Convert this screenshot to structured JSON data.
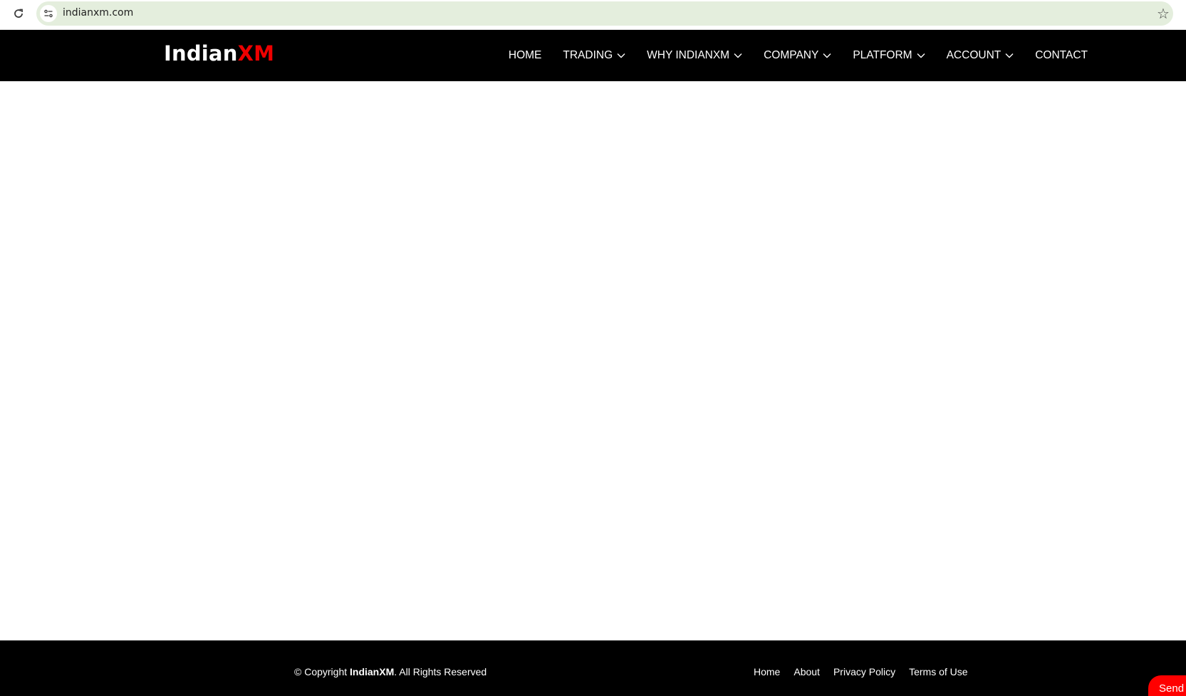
{
  "browser": {
    "url": "indianxm.com",
    "icons": {
      "reload": "reload-icon",
      "site_info": "site-settings-icon",
      "bookmark": "star-icon"
    }
  },
  "header": {
    "logo": {
      "main": "Indian",
      "accent": "XM"
    },
    "nav": [
      {
        "label": "HOME",
        "dropdown": false
      },
      {
        "label": "TRADING",
        "dropdown": true
      },
      {
        "label": "WHY INDIANXM",
        "dropdown": true
      },
      {
        "label": "COMPANY",
        "dropdown": true
      },
      {
        "label": "PLATFORM",
        "dropdown": true
      },
      {
        "label": "ACCOUNT",
        "dropdown": true
      },
      {
        "label": "CONTACT",
        "dropdown": false
      }
    ]
  },
  "footer": {
    "copyright_prefix": "© Copyright ",
    "copyright_brand": "IndianXM",
    "copyright_suffix": ". All Rights Reserved",
    "links": [
      "Home",
      "About",
      "Privacy Policy",
      "Terms of Use"
    ]
  },
  "send_button": {
    "label": "Send"
  },
  "colors": {
    "header_bg": "#000000",
    "accent": "#ee0000",
    "omnibox_bg": "#e4eedd",
    "send_bg": "#ff0000"
  }
}
